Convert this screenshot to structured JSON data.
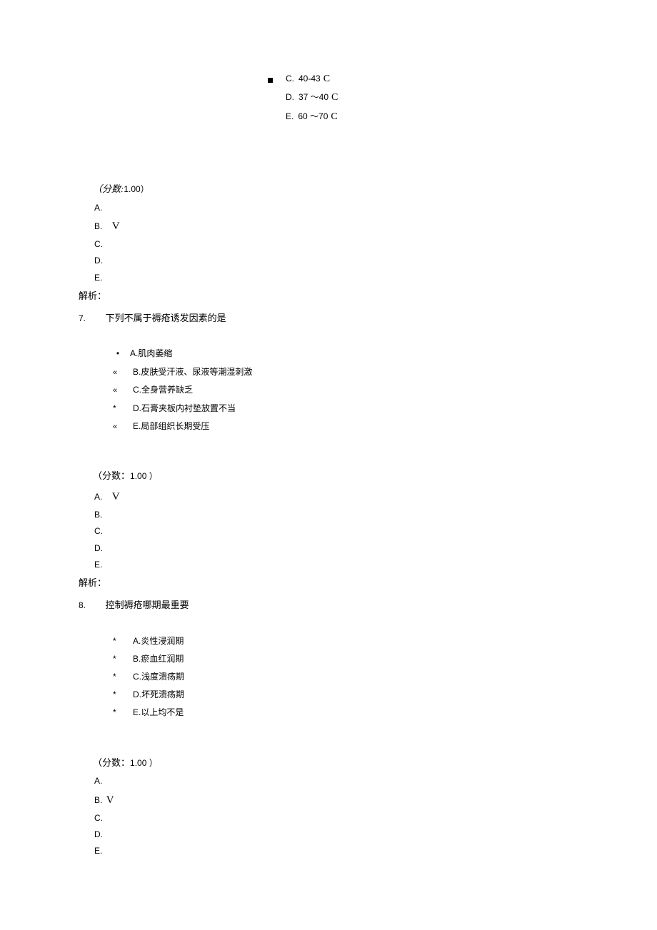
{
  "top_options": {
    "c": {
      "bullet": "■",
      "letter": "C.",
      "text": "40-43",
      "unit": "C"
    },
    "d": {
      "bullet": "",
      "letter": "D.",
      "text": "37 ～40",
      "unit": "C"
    },
    "e": {
      "bullet": "",
      "letter": "E.",
      "text": "60 ～70",
      "unit": "C"
    }
  },
  "q6": {
    "score_label_italic": "（分数:",
    "score_value": "1.00）",
    "answers": {
      "a": "A.",
      "b": "B.",
      "b_tick": "V",
      "c": "C.",
      "d": "D.",
      "e": "E."
    },
    "jiexi": "解析："
  },
  "q7": {
    "num": "7.",
    "text": "下列不属于褥疮诱发因素的是",
    "options": {
      "a": {
        "bullet": "•",
        "label": "A.",
        "text": "肌肉萎缩"
      },
      "b": {
        "bullet": "«",
        "label": "B.",
        "text": "皮肤受汗液、尿液等潮湿刺激"
      },
      "c": {
        "bullet": "«",
        "label": "C.",
        "text": "全身营养缺乏"
      },
      "d": {
        "bullet": "*",
        "label": "D.",
        "text": "石膏夹板内衬垫放置不当"
      },
      "e": {
        "bullet": "«",
        "label": "E.",
        "text": "局部组织长期受压"
      }
    },
    "score_label": "（分数：",
    "score_value": "1.00 ）",
    "answers": {
      "a": "A.",
      "a_tick": "V",
      "b": "B.",
      "c": "C.",
      "d": "D.",
      "e": "E."
    },
    "jiexi": "解析："
  },
  "q8": {
    "num": "8.",
    "text": "控制褥疮哪期最重要",
    "options": {
      "a": {
        "bullet": "*",
        "label": "A.",
        "text": "炎性浸润期"
      },
      "b": {
        "bullet": "*",
        "label": "B.",
        "text": "瘀血红润期"
      },
      "c": {
        "bullet": "*",
        "label": "C.",
        "text": "浅度溃疡期"
      },
      "d": {
        "bullet": "*",
        "label": "D.",
        "text": "坏死溃疡期"
      },
      "e": {
        "bullet": "*",
        "label": "E.",
        "text": "以上均不是"
      }
    },
    "score_label": "（分数：",
    "score_value": "1.00 ）",
    "answers": {
      "a": "A.",
      "b": "B.",
      "b_tick": "V",
      "c": "C.",
      "d": "D.",
      "e": "E."
    }
  }
}
